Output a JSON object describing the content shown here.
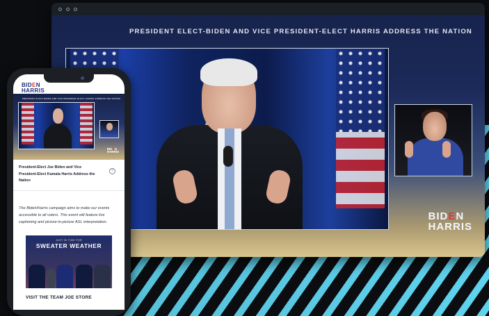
{
  "window": {
    "banner": "PRESIDENT ELECT-BIDEN AND VICE PRESIDENT-ELECT HARRIS ADDRESS THE NATION"
  },
  "logo": {
    "line1_a": "BID",
    "line1_e": "E",
    "line1_b": "N",
    "line2": "HARRIS"
  },
  "phone": {
    "event_title": "President-Elect Joe Biden and Vice President-Elect Kamala Harris Address the Nation",
    "help_icon": "?",
    "accessibility_note": "The Biden/Harris campaign aims to make our events accessible to all voters. This event will feature live captioning and picture-in-picture ASL interpretation.",
    "promo": {
      "kicker": "JUST IN TIME FOR",
      "headline": "SWEATER WEATHER"
    },
    "store_link": "VISIT THE TEAM JOE STORE"
  },
  "colors": {
    "accent_red": "#d73b3e",
    "brand_navy": "#1b2f7a",
    "stripe_cyan": "#5fd3ee"
  }
}
